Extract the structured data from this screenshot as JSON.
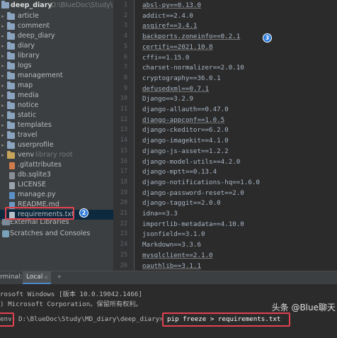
{
  "project_tree": {
    "root": {
      "name": "deep_diary",
      "path": "D:\\BlueDoc\\Study\\MD_..."
    },
    "items": [
      {
        "label": "article",
        "kind": "folder"
      },
      {
        "label": "comment",
        "kind": "folder"
      },
      {
        "label": "deep_diary",
        "kind": "folder"
      },
      {
        "label": "diary",
        "kind": "folder"
      },
      {
        "label": "library",
        "kind": "folder"
      },
      {
        "label": "logs",
        "kind": "folder"
      },
      {
        "label": "management",
        "kind": "folder"
      },
      {
        "label": "map",
        "kind": "folder"
      },
      {
        "label": "media",
        "kind": "folder"
      },
      {
        "label": "notice",
        "kind": "folder"
      },
      {
        "label": "static",
        "kind": "folder"
      },
      {
        "label": "templates",
        "kind": "folder"
      },
      {
        "label": "travel",
        "kind": "folder"
      },
      {
        "label": "userprofile",
        "kind": "folder"
      },
      {
        "label": "venv",
        "kind": "venv-folder",
        "suffix": "library root"
      },
      {
        "label": ".gitattributes",
        "kind": "file-git"
      },
      {
        "label": "db.sqlite3",
        "kind": "file-db"
      },
      {
        "label": "LICENSE",
        "kind": "file"
      },
      {
        "label": "manage.py",
        "kind": "file-py"
      },
      {
        "label": "README.md",
        "kind": "file-md"
      },
      {
        "label": "requirements.txt",
        "kind": "file-txt",
        "selected": true
      }
    ],
    "external_libraries": "External Libraries",
    "scratches": "Scratches and Consoles",
    "badge_2": "2"
  },
  "editor": {
    "badge_3": "3",
    "lines": [
      {
        "n": "1",
        "text": "absl-py==0.13.0",
        "ul": true
      },
      {
        "n": "2",
        "text": "addict==2.4.0",
        "ul": false
      },
      {
        "n": "3",
        "text": "asgiref==3.4.1",
        "ul": true
      },
      {
        "n": "4",
        "text": "backports.zoneinfo==0.2.1",
        "ul": true
      },
      {
        "n": "5",
        "text": "certifi==2021.10.8",
        "ul": true
      },
      {
        "n": "6",
        "text": "cffi==1.15.0",
        "ul": false
      },
      {
        "n": "7",
        "text": "charset-normalizer==2.0.10",
        "ul": false
      },
      {
        "n": "8",
        "text": "cryptography==36.0.1",
        "ul": false
      },
      {
        "n": "9",
        "text": "defusedxml==0.7.1",
        "ul": true
      },
      {
        "n": "10",
        "text": "Django==3.2.9",
        "ul": false
      },
      {
        "n": "11",
        "text": "django-allauth==0.47.0",
        "ul": false
      },
      {
        "n": "12",
        "text": "django-appconf==1.0.5",
        "ul": true
      },
      {
        "n": "13",
        "text": "django-ckeditor==6.2.0",
        "ul": false
      },
      {
        "n": "14",
        "text": "django-imagekit==4.1.0",
        "ul": false
      },
      {
        "n": "15",
        "text": "django-js-asset==1.2.2",
        "ul": false
      },
      {
        "n": "16",
        "text": "django-model-utils==4.2.0",
        "ul": false
      },
      {
        "n": "17",
        "text": "django-mptt==0.13.4",
        "ul": false
      },
      {
        "n": "18",
        "text": "django-notifications-hq==1.6.0",
        "ul": false
      },
      {
        "n": "19",
        "text": "django-password-reset==2.0",
        "ul": false
      },
      {
        "n": "20",
        "text": "django-taggit==2.0.0",
        "ul": false
      },
      {
        "n": "21",
        "text": "idna==3.3",
        "ul": false
      },
      {
        "n": "22",
        "text": "importlib-metadata==4.10.0",
        "ul": false
      },
      {
        "n": "23",
        "text": "jsonfield==3.1.0",
        "ul": false
      },
      {
        "n": "24",
        "text": "Markdown==3.3.6",
        "ul": false
      },
      {
        "n": "25",
        "text": "mysqlclient==2.1.0",
        "ul": true
      },
      {
        "n": "26",
        "text": "oauthlib==3.1.1",
        "ul": true
      }
    ]
  },
  "terminal": {
    "title": "rminal:",
    "tab": "Local",
    "add": "+",
    "lines": [
      "rosoft Windows [版本 10.0.19042.1466]",
      ") Microsoft Corporation。保留所有权利。"
    ],
    "prompt_env": "env)",
    "prompt_path": "D:\\BlueDoc\\Study\\MD_diary\\deep_diary>",
    "command": "pip freeze > requirements.txt"
  },
  "watermark": "头条 @Blue聊天"
}
